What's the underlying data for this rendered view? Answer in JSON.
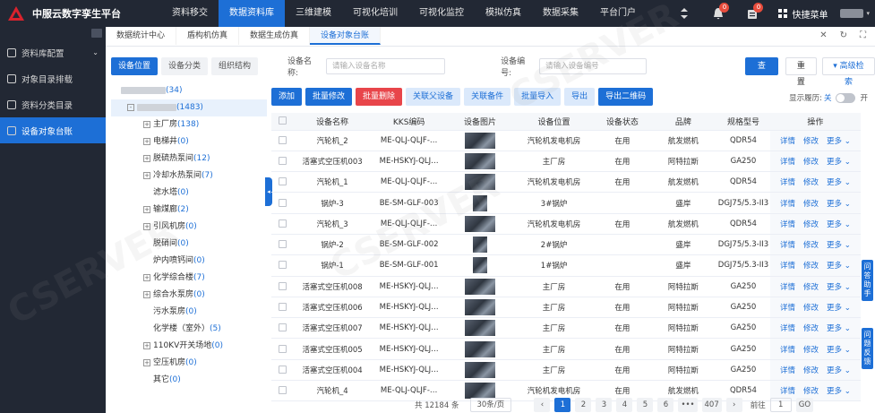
{
  "app": {
    "title": "中服云数字孪生平台"
  },
  "nav": [
    "资料移交",
    "数据资料库",
    "三维建模",
    "可视化培训",
    "可视化监控",
    "模拟仿真",
    "数据采集",
    "平台门户"
  ],
  "nav_active": 1,
  "topright": {
    "badge1": "0",
    "badge2": "0",
    "quick": "快捷菜单"
  },
  "sidebar": [
    {
      "label": "资料库配置",
      "active": false,
      "arrow": "⌄"
    },
    {
      "label": "对象目录排载",
      "active": false,
      "arrow": ""
    },
    {
      "label": "资料分类目录",
      "active": false,
      "arrow": ""
    },
    {
      "label": "设备对象台账",
      "active": true,
      "arrow": ""
    }
  ],
  "tabs": [
    "数据统计中心",
    "盾构机仿真",
    "数据生成仿真",
    "设备对象台账"
  ],
  "tab_active": 3,
  "left_tabs": [
    "设备位置",
    "设备分类",
    "组织结构"
  ],
  "tree": [
    {
      "label": "",
      "count": "(34)",
      "blur": 50,
      "indent": 0,
      "pm": ""
    },
    {
      "label": "",
      "count": "(1483)",
      "blur": 44,
      "indent": 1,
      "pm": "-",
      "sel": true
    },
    {
      "label": "主厂房",
      "count": "(138)",
      "indent": 2,
      "pm": "+"
    },
    {
      "label": "电梯井",
      "count": "(0)",
      "indent": 2,
      "pm": "+"
    },
    {
      "label": "脱硫热泵间",
      "count": "(12)",
      "indent": 2,
      "pm": "+"
    },
    {
      "label": "冷却水热泵间",
      "count": "(7)",
      "indent": 2,
      "pm": "+"
    },
    {
      "label": "滤水塔",
      "count": "(0)",
      "indent": 2,
      "pm": ""
    },
    {
      "label": "输煤廊",
      "count": "(2)",
      "indent": 2,
      "pm": "+"
    },
    {
      "label": "引风机房",
      "count": "(0)",
      "indent": 2,
      "pm": "+"
    },
    {
      "label": "脱硝间",
      "count": "(0)",
      "indent": 2,
      "pm": ""
    },
    {
      "label": "炉内喷钙间",
      "count": "(0)",
      "indent": 2,
      "pm": ""
    },
    {
      "label": "化学综合楼",
      "count": "(7)",
      "indent": 2,
      "pm": "+"
    },
    {
      "label": "综合水泵房",
      "count": "(0)",
      "indent": 2,
      "pm": "+"
    },
    {
      "label": "污水泵房",
      "count": "(0)",
      "indent": 2,
      "pm": ""
    },
    {
      "label": "化学楼（室外）",
      "count": "(5)",
      "indent": 2,
      "pm": ""
    },
    {
      "label": "110KV开关场地",
      "count": "(0)",
      "indent": 2,
      "pm": "+"
    },
    {
      "label": "空压机房",
      "count": "(0)",
      "indent": 2,
      "pm": "+"
    },
    {
      "label": "其它",
      "count": "(0)",
      "indent": 2,
      "pm": ""
    }
  ],
  "search": {
    "name_label": "设备名称:",
    "name_placeholder": "请输入设备名称",
    "code_label": "设备编号:",
    "code_placeholder": "请输入设备编号",
    "query": "查 询",
    "reset": "重 置",
    "advanced": "▾ 高级检索"
  },
  "actions": [
    {
      "label": "添加",
      "style": "blue"
    },
    {
      "label": "批量修改",
      "style": "blue"
    },
    {
      "label": "批量删除",
      "style": "red"
    },
    {
      "label": "关联父设备",
      "style": "light"
    },
    {
      "label": "关联备件",
      "style": "light"
    },
    {
      "label": "批量导入",
      "style": "light"
    },
    {
      "label": "导出",
      "style": "light"
    },
    {
      "label": "导出二维码",
      "style": "blue"
    }
  ],
  "history": {
    "label": "显示履历:",
    "off": "关",
    "on": "开"
  },
  "table": {
    "headers": [
      "",
      "设备名称",
      "KKS编码",
      "设备图片",
      "设备位置",
      "设备状态",
      "品牌",
      "规格型号",
      "操作"
    ],
    "rows": [
      [
        "汽轮机_2",
        "ME-QLJ-QLJF-…",
        "汽轮机发电机房",
        "在用",
        "航发燃机",
        "QDR54"
      ],
      [
        "活塞式空压机003",
        "ME-HSKYJ-QLJ…",
        "主厂房",
        "在用",
        "阿特拉斯",
        "GA250"
      ],
      [
        "汽轮机_1",
        "ME-QLJ-QLJF-…",
        "汽轮机发电机房",
        "在用",
        "航发燃机",
        "QDR54"
      ],
      [
        "锅炉-3",
        "BE-SM-GLF-003",
        "3#锅炉",
        "",
        "盛岸",
        "DGJ75/5.3-II3"
      ],
      [
        "汽轮机_3",
        "ME-QLJ-QLJF-…",
        "汽轮机发电机房",
        "在用",
        "航发燃机",
        "QDR54"
      ],
      [
        "锅炉-2",
        "BE-SM-GLF-002",
        "2#锅炉",
        "",
        "盛岸",
        "DGJ75/5.3-II3"
      ],
      [
        "锅炉-1",
        "BE-SM-GLF-001",
        "1#锅炉",
        "",
        "盛岸",
        "DGJ75/5.3-II3"
      ],
      [
        "活塞式空压机008",
        "ME-HSKYJ-QLJ…",
        "主厂房",
        "在用",
        "阿特拉斯",
        "GA250"
      ],
      [
        "活塞式空压机006",
        "ME-HSKYJ-QLJ…",
        "主厂房",
        "在用",
        "阿特拉斯",
        "GA250"
      ],
      [
        "活塞式空压机007",
        "ME-HSKYJ-QLJ…",
        "主厂房",
        "在用",
        "阿特拉斯",
        "GA250"
      ],
      [
        "活塞式空压机005",
        "ME-HSKYJ-QLJ…",
        "主厂房",
        "在用",
        "阿特拉斯",
        "GA250"
      ],
      [
        "活塞式空压机004",
        "ME-HSKYJ-QLJ…",
        "主厂房",
        "在用",
        "阿特拉斯",
        "GA250"
      ],
      [
        "汽轮机_4",
        "ME-QLJ-QLJF-…",
        "汽轮机发电机房",
        "在用",
        "航发燃机",
        "QDR54"
      ]
    ],
    "ops": [
      "详情",
      "修改",
      "更多 ⌄"
    ]
  },
  "pager": {
    "total": "共 12184 条",
    "size": "30条/页",
    "prev": "‹",
    "pages": [
      "1",
      "2",
      "3",
      "4",
      "5",
      "6",
      "•••",
      "407"
    ],
    "next": "›",
    "goto": "前往",
    "page": "1",
    "go": "GO"
  },
  "float": {
    "assistant": "问答助手",
    "feedback": "问题反馈"
  },
  "colors": {
    "primary": "#1d6fd6",
    "danger": "#e8454a",
    "dark": "#222834"
  }
}
